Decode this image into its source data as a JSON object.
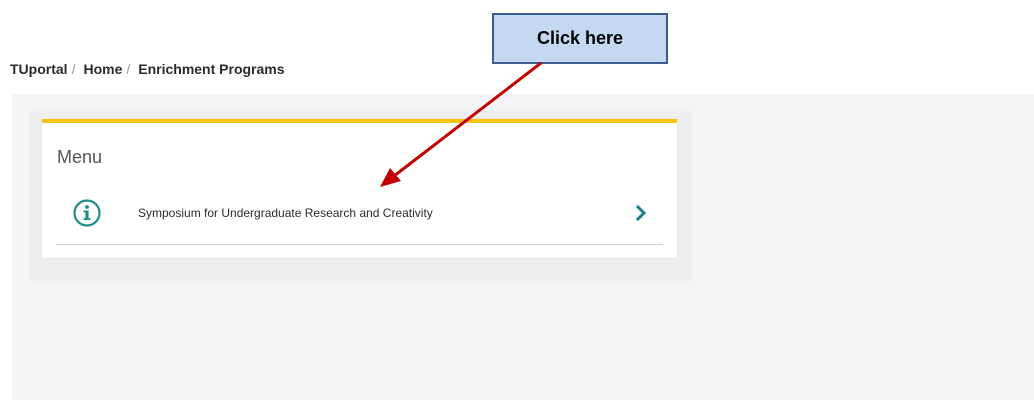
{
  "breadcrumb": {
    "items": [
      "TUportal",
      "Home",
      "Enrichment Programs"
    ],
    "separator": "/"
  },
  "menu": {
    "title": "Menu",
    "items": [
      {
        "label": "Symposium for Undergraduate Research and Creativity",
        "icon": "info-circle-icon"
      }
    ]
  },
  "annotation": {
    "callout_text": "Click here",
    "callout_fill": "#c5d8f1",
    "callout_border": "#3c5d8d",
    "arrow_color": "#c00000"
  },
  "colors": {
    "accent_yellow": "#f6c313",
    "icon_teal": "#1f8c8c",
    "chevron_teal": "#1a7f8a"
  }
}
